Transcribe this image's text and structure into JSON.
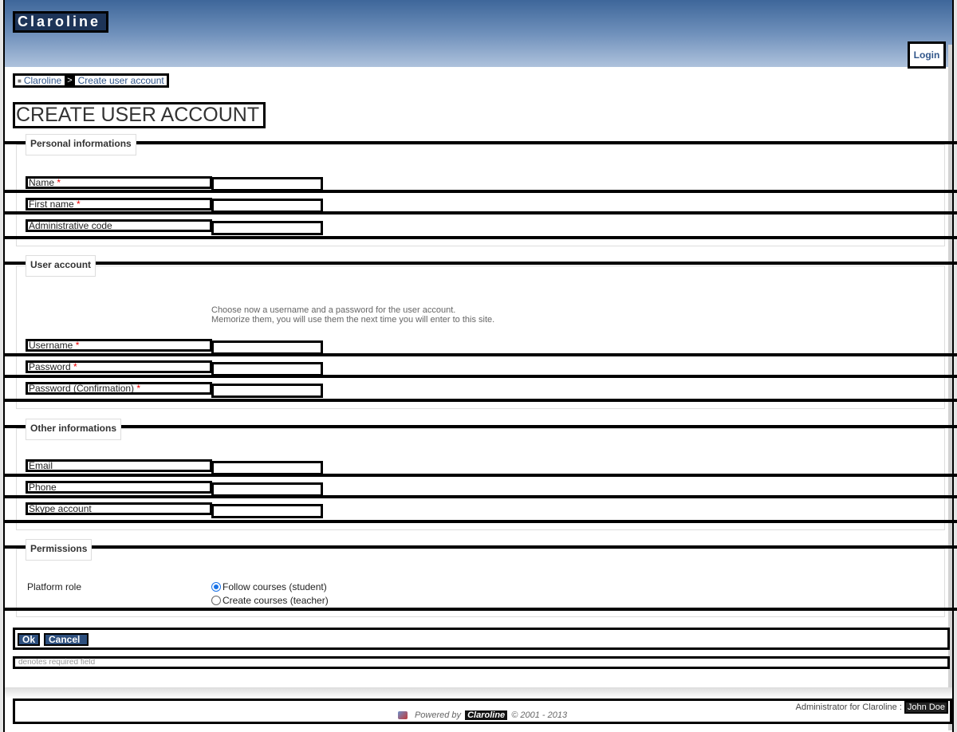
{
  "header": {
    "logo_text": "Claroline",
    "login_label": "Login"
  },
  "breadcrumb": {
    "home_label": "Claroline",
    "separator": ">",
    "current_label": "Create user account"
  },
  "page_title": "CREATE USER ACCOUNT",
  "sections": {
    "personal": {
      "legend": "Personal informations",
      "fields": [
        {
          "label": "Name",
          "required": "*",
          "value": ""
        },
        {
          "label": "First name",
          "required": "*",
          "value": ""
        },
        {
          "label": "Administrative code",
          "required": "",
          "value": ""
        }
      ]
    },
    "account": {
      "legend": "User account",
      "hint_line1": "Choose now a username and a password for the user account.",
      "hint_line2": "Memorize them, you will use them the next time you will enter to this site.",
      "fields": [
        {
          "label": "Username",
          "required": "*",
          "value": ""
        },
        {
          "label": "Password",
          "required": "*",
          "value": ""
        },
        {
          "label": "Password (Confirmation)",
          "required": "*",
          "value": ""
        }
      ]
    },
    "other": {
      "legend": "Other informations",
      "fields": [
        {
          "label": "Email",
          "required": "",
          "value": ""
        },
        {
          "label": "Phone",
          "required": "",
          "value": ""
        },
        {
          "label": "Skype account",
          "required": "",
          "value": ""
        }
      ]
    },
    "permissions": {
      "legend": "Permissions",
      "platform_role_label": "Platform role",
      "options": [
        {
          "label": "Follow courses (student)",
          "checked": true
        },
        {
          "label": "Create courses (teacher)",
          "checked": false
        }
      ]
    }
  },
  "actions": {
    "ok_label": "Ok",
    "cancel_label": "Cancel"
  },
  "required_note": "denotes required field",
  "footer": {
    "admin_text": "Administrator for Claroline :",
    "admin_name": "John Doe",
    "powered_prefix": "Powered by",
    "powered_brand": "Claroline",
    "powered_suffix": "© 2001 - 2013"
  },
  "colors": {
    "banner_top": "#3e669a",
    "link": "#31568a",
    "button_bg": "#2d4f7e",
    "required": "#ee0000"
  }
}
